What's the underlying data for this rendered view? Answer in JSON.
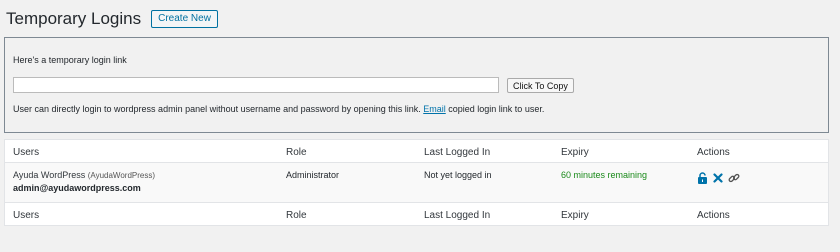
{
  "header": {
    "title": "Temporary Logins",
    "create_label": "Create New"
  },
  "link_box": {
    "heading": "Here's a temporary login link",
    "input_value": "",
    "copy_label": "Click To Copy",
    "note_before": "User can directly login to wordpress admin panel without username and password by opening this link.",
    "note_link": "Email",
    "note_after": "copied login link to user."
  },
  "table": {
    "columns": {
      "users": "Users",
      "role": "Role",
      "last_logged_in": "Last Logged In",
      "expiry": "Expiry",
      "actions": "Actions"
    },
    "rows": [
      {
        "name": "Ayuda WordPress",
        "login": "(AyudaWordPress)",
        "email": "admin@ayudawordpress.com",
        "role": "Administrator",
        "last_logged_in": "Not yet logged in",
        "expiry": "60 minutes remaining",
        "actions": [
          "lock-icon",
          "close-icon",
          "link-icon"
        ]
      }
    ]
  },
  "colors": {
    "accent": "#0073aa",
    "expiry_green": "#1a8a1a"
  }
}
